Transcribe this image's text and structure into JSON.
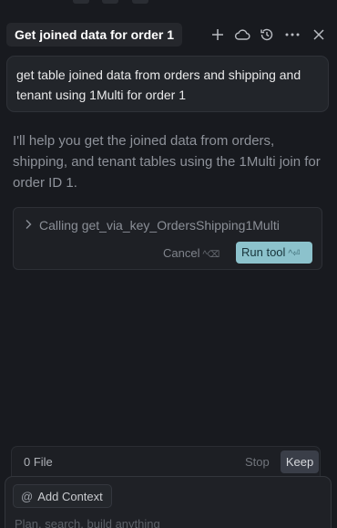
{
  "header": {
    "title": "Get joined data for order 1",
    "icons": [
      "plus-icon",
      "cloud-icon",
      "history-icon",
      "more-icon",
      "close-icon"
    ]
  },
  "chat": {
    "user_message": "get table joined data from orders and shipping and tenant using 1Multi for order 1",
    "assistant_message": "I'll help you get the joined data from orders, shipping, and tenant tables using the 1Multi join for order ID 1."
  },
  "tool_call": {
    "label": "Calling get_via_key_OrdersShipping1Multi",
    "cancel_label": "Cancel",
    "cancel_shortcut": "^⌫",
    "run_label": "Run tool",
    "run_shortcut": "^⏎",
    "run_color": "#8cc2cc"
  },
  "file_bar": {
    "count_label": "0 File",
    "stop_label": "Stop",
    "keep_label": "Keep"
  },
  "composer": {
    "context_label": "Add Context",
    "placeholder": "Plan, search, build anything"
  }
}
